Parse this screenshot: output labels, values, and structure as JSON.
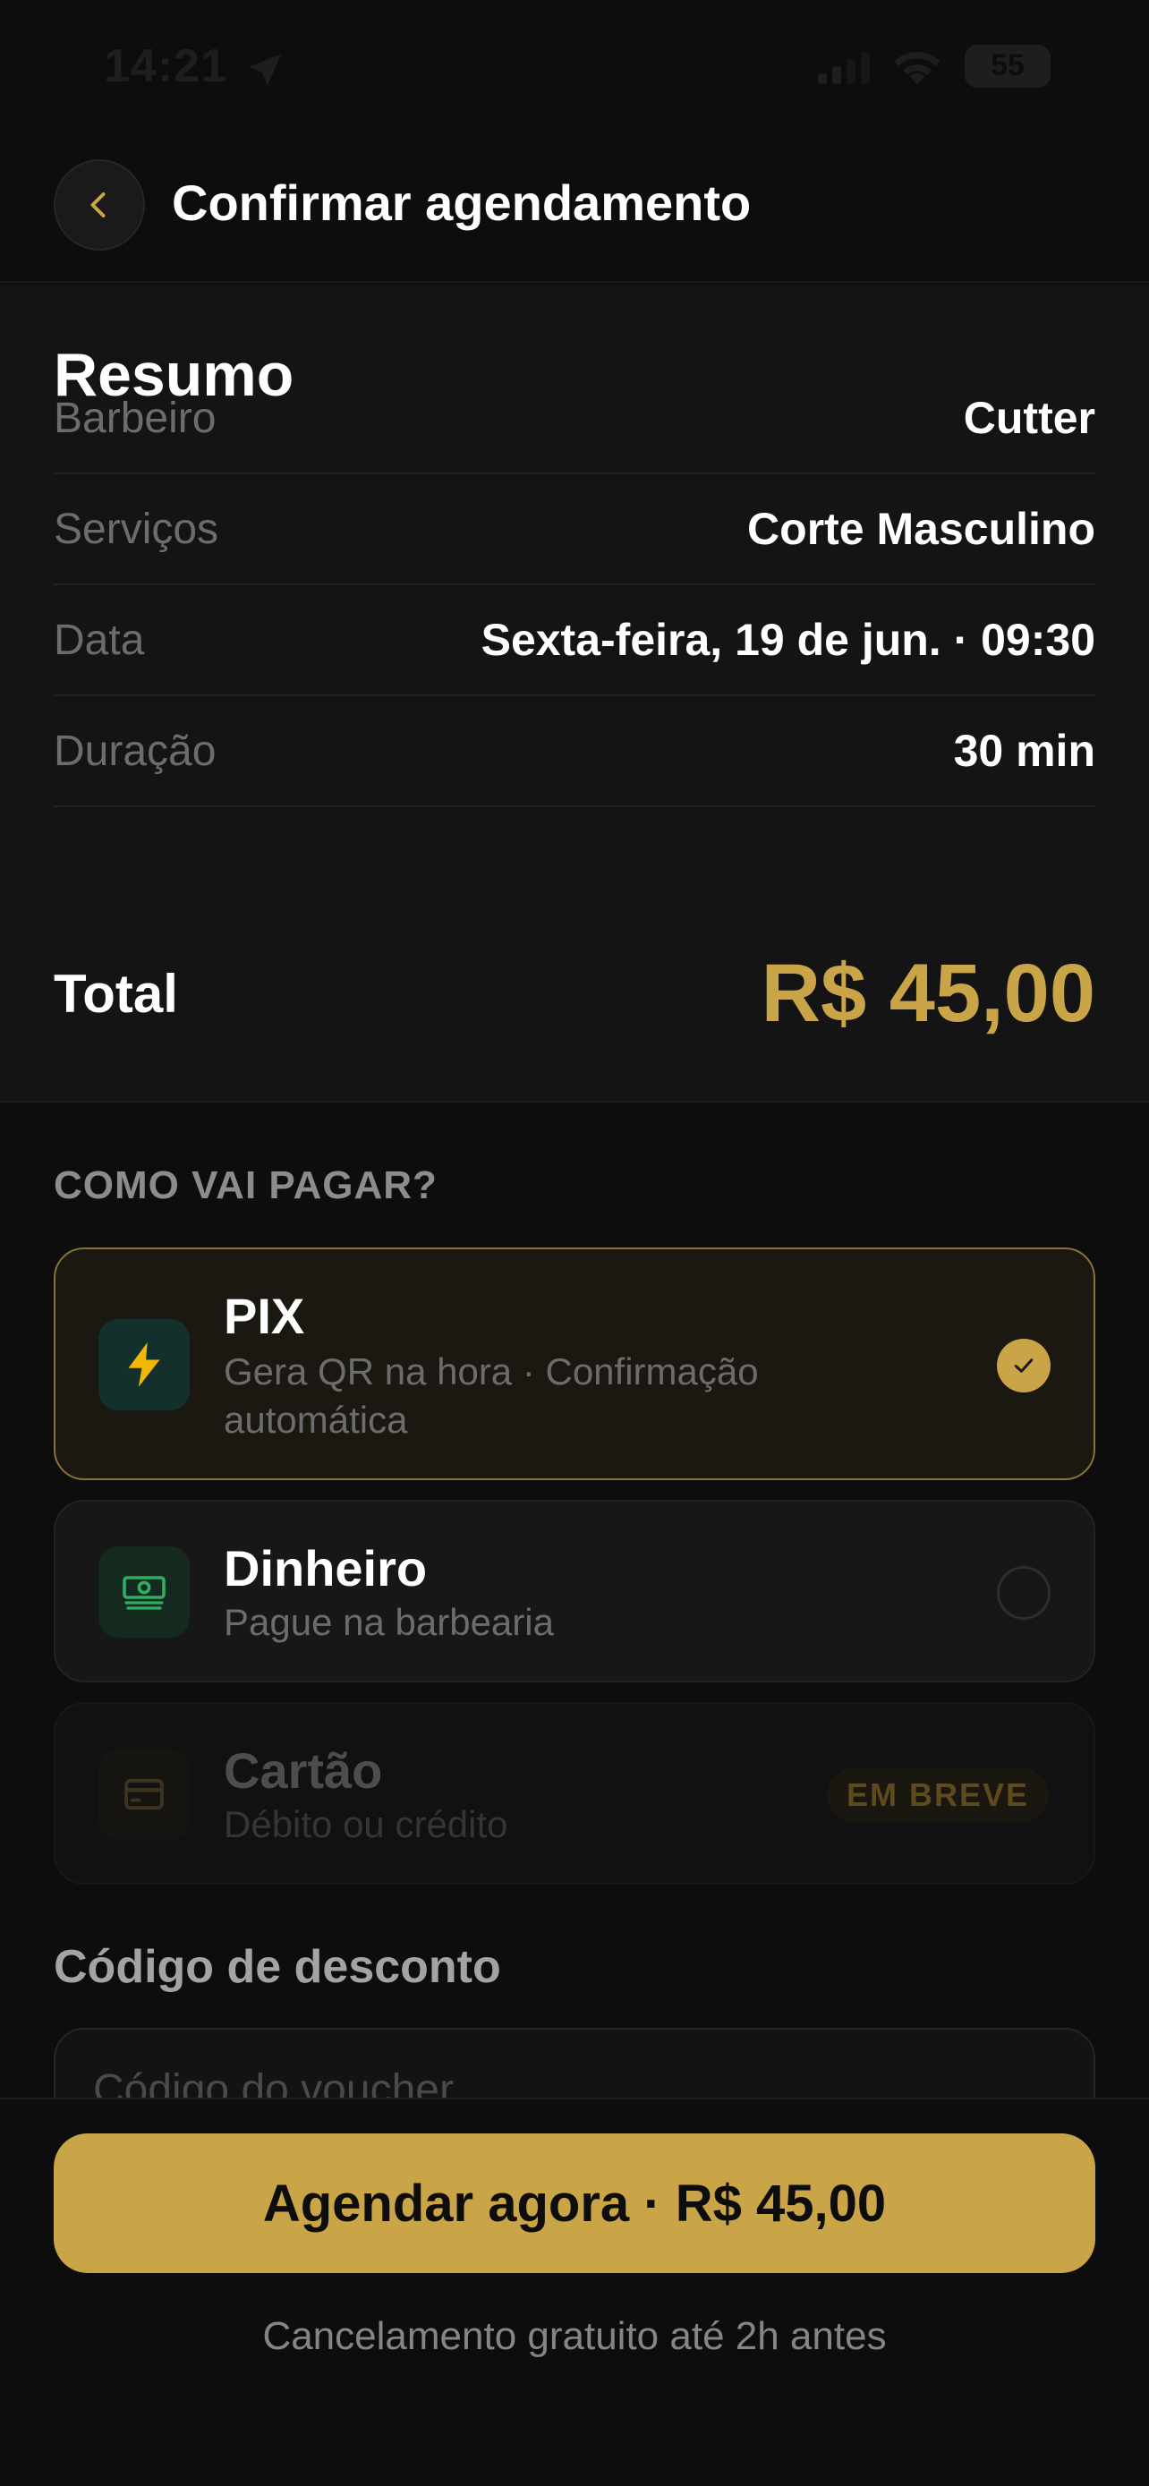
{
  "status_bar": {
    "time": "14:21",
    "battery": "55"
  },
  "header": {
    "title": "Confirmar agendamento"
  },
  "summary": {
    "title": "Resumo",
    "rows": [
      {
        "label": "Barbeiro",
        "value": "Cutter"
      },
      {
        "label": "Serviços",
        "value": "Corte Masculino"
      },
      {
        "label": "Data",
        "value": "Sexta-feira, 19 de jun. · 09:30"
      },
      {
        "label": "Duração",
        "value": "30 min"
      }
    ],
    "total_label": "Total",
    "total_value": "R$ 45,00"
  },
  "payment": {
    "title": "COMO VAI PAGAR?",
    "options": [
      {
        "name": "PIX",
        "desc": "Gera QR na hora · Confirmação automática",
        "icon": "lightning-icon",
        "state": "selected"
      },
      {
        "name": "Dinheiro",
        "desc": "Pague na barbearia",
        "icon": "cash-icon",
        "state": "unselected"
      },
      {
        "name": "Cartão",
        "desc": "Débito ou crédito",
        "icon": "credit-card-icon",
        "state": "disabled",
        "badge": "EM BREVE"
      }
    ]
  },
  "discount": {
    "title": "Código de desconto",
    "placeholder": "Código do voucher",
    "value": ""
  },
  "footer": {
    "cta_label": "Agendar agora · R$ 45,00",
    "note": "Cancelamento gratuito até 2h antes"
  },
  "colors": {
    "accent": "#c9a548",
    "background": "#0d0d0d",
    "card": "#171717",
    "pix_icon_bg": "#14302c",
    "cash_green": "#2fae63"
  }
}
